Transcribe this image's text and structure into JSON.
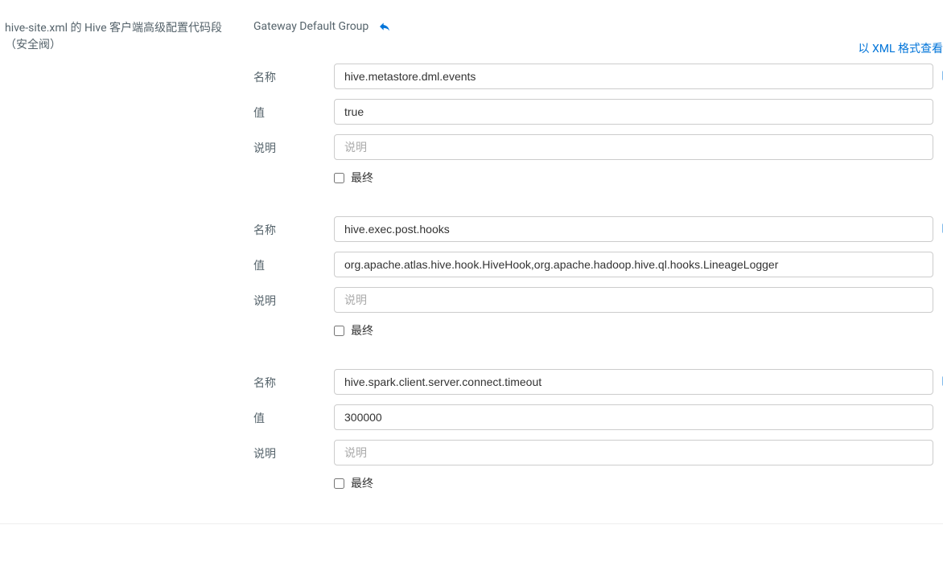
{
  "left": {
    "title_line1": "hive-site.xml 的 Hive 客户端高级配置代码段",
    "title_line2": "（安全阀）"
  },
  "header": {
    "group_name": "Gateway Default Group",
    "xml_link": "以 XML 格式查看"
  },
  "labels": {
    "name": "名称",
    "value": "值",
    "desc": "说明",
    "final": "最终",
    "desc_placeholder": "说明"
  },
  "entries": [
    {
      "name": "hive.metastore.dml.events",
      "value": "true",
      "desc": "",
      "final": false
    },
    {
      "name": "hive.exec.post.hooks",
      "value": "org.apache.atlas.hive.hook.HiveHook,org.apache.hadoop.hive.ql.hooks.LineageLogger",
      "desc": "",
      "final": false
    },
    {
      "name": "hive.spark.client.server.connect.timeout",
      "value": "300000",
      "desc": "",
      "final": false
    }
  ]
}
